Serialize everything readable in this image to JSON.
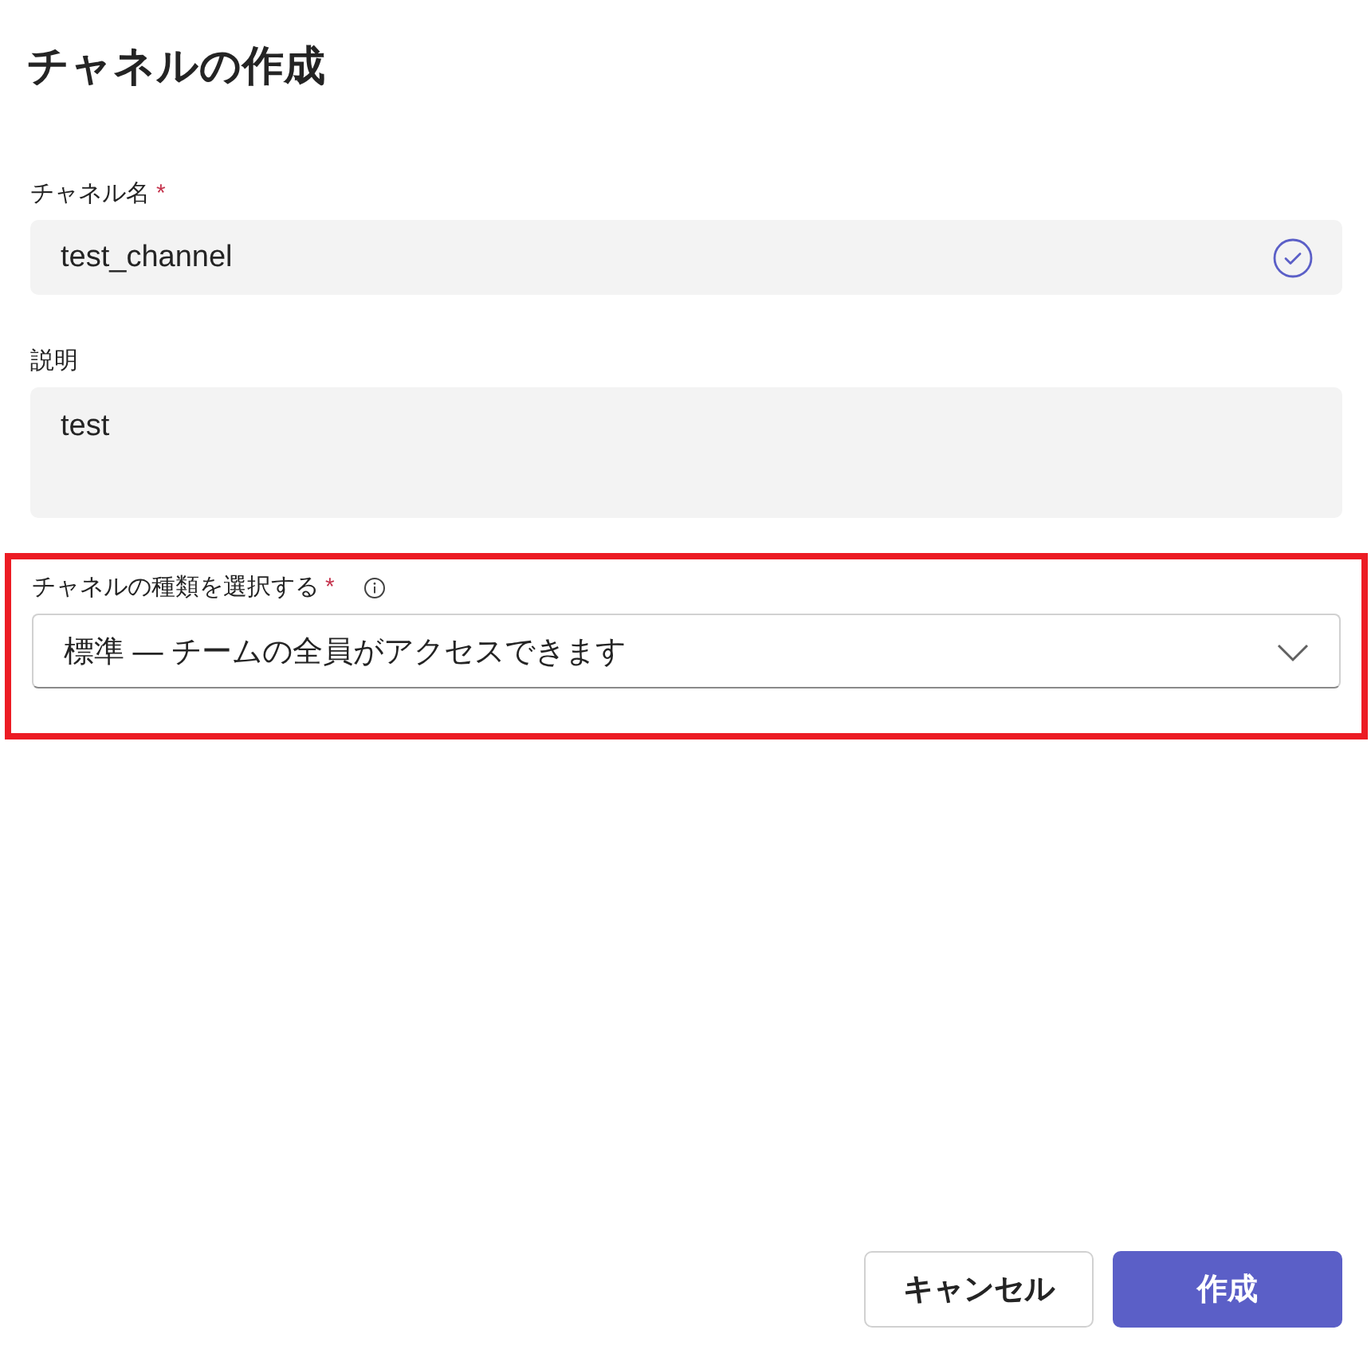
{
  "dialog": {
    "title": "チャネルの作成"
  },
  "channel_name": {
    "label": "チャネル名",
    "required_mark": "*",
    "value": "test_channel",
    "valid": true
  },
  "description": {
    "label": "説明",
    "value": "test"
  },
  "channel_type": {
    "label": "チャネルの種類を選択する",
    "required_mark": "*",
    "value": "標準 — チームの全員がアクセスできます",
    "highlighted": true
  },
  "buttons": [
    {
      "label": "キャンセル",
      "kind": "secondary"
    },
    {
      "label": "作成",
      "kind": "primary"
    }
  ]
}
